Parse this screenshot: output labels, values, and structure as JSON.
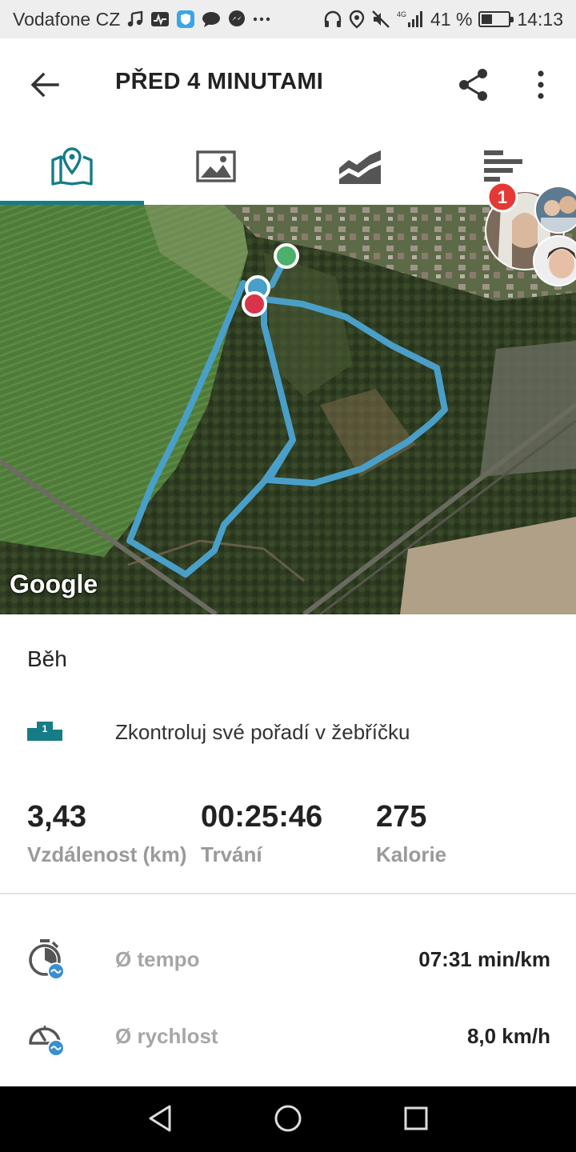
{
  "status_bar": {
    "carrier": "Vodafone CZ",
    "network": "4G",
    "battery": "41 %",
    "battery_level": 0.41,
    "time": "14:13"
  },
  "header": {
    "title": "PŘED 4 MINUTAMI",
    "back_icon": "arrow-left-icon",
    "share_icon": "share-icon",
    "more_icon": "more-vertical-icon"
  },
  "tabs": [
    {
      "icon": "map-pin-icon",
      "active": true
    },
    {
      "icon": "image-icon",
      "active": false
    },
    {
      "icon": "chart-icon",
      "active": false
    },
    {
      "icon": "splits-icon",
      "active": false
    }
  ],
  "map": {
    "attribution": "Google",
    "notification_count": "1",
    "route_color": "#4a9fc8",
    "start_color": "#4caf6a",
    "end_color": "#d8344a"
  },
  "activity": {
    "type": "Běh",
    "leaderboard_badge": "1",
    "leaderboard_text": "Zkontroluj své pořadí v žebříčku"
  },
  "stats": [
    {
      "value": "3,43",
      "label": "Vzdálenost (km)"
    },
    {
      "value": "00:25:46",
      "label": "Trvání"
    },
    {
      "value": "275",
      "label": "Kalorie"
    }
  ],
  "details": [
    {
      "icon": "stopwatch-icon",
      "label": "Ø tempo",
      "value": "07:31 min/km"
    },
    {
      "icon": "speedometer-icon",
      "label": "Ø rychlost",
      "value": "8,0 km/h"
    }
  ],
  "colors": {
    "accent": "#167c86",
    "badge": "#e53935"
  }
}
